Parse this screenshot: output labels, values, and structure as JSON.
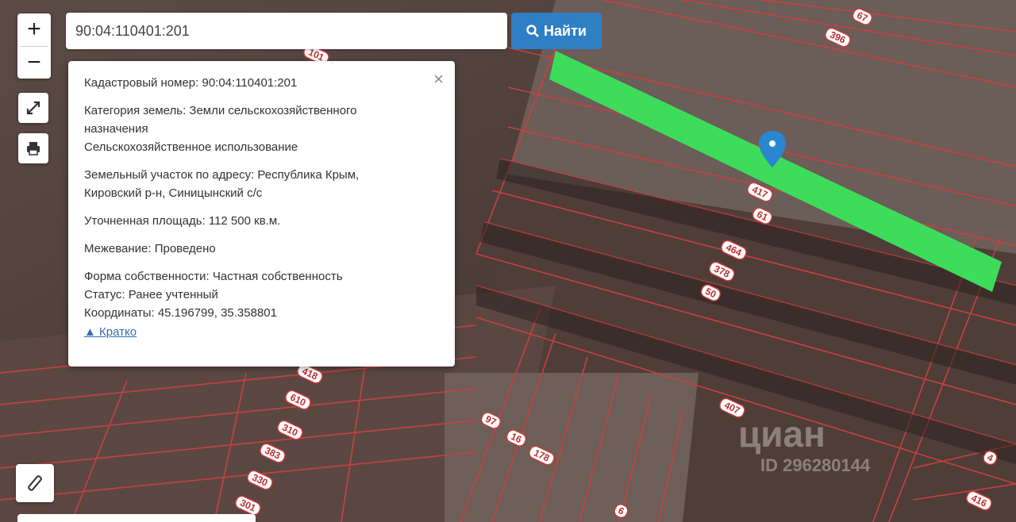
{
  "search": {
    "value": "90:04:110401:201",
    "button_label": "Найти"
  },
  "zoom": {
    "in_label": "+",
    "out_label": "−"
  },
  "tools": {
    "expand_icon": "expand-icon",
    "print_icon": "print-icon",
    "measure_icon": "ruler-icon"
  },
  "popup": {
    "close_label": "×",
    "cadastral_number": "Кадастровый номер: 90:04:110401:201",
    "land_category_line1": "Категория земель: Земли сельскохозяйственного",
    "land_category_line2": "назначения",
    "permitted_use": "Сельскохозяйственное использование",
    "address_line1": "Земельный участок по адресу: Республика Крым,",
    "address_line2": "Кировский р-н, Синицынский с/с",
    "area": "Уточненная площадь: 112 500 кв.м.",
    "survey": "Межевание: Проведено",
    "ownership": "Форма собственности: Частная собственность",
    "status": "Статус: Ранее учтенный",
    "coordinates": "Координаты: 45.196799, 35.358801",
    "collapse_link": "▲ Кратко"
  },
  "parcel_labels": [
    "67",
    "396",
    "101",
    "417",
    "61",
    "464",
    "378",
    "50",
    "418",
    "610",
    "310",
    "383",
    "330",
    "301",
    "97",
    "16",
    "178",
    "407",
    "4",
    "6",
    "416"
  ],
  "colors": {
    "highlight": "#3ddc5a",
    "parcel_border": "#d83a3a",
    "marker": "#2a86d0",
    "button": "#2f7fc4"
  },
  "watermark": {
    "brand": "циан",
    "id_text": "ID 296280144"
  }
}
